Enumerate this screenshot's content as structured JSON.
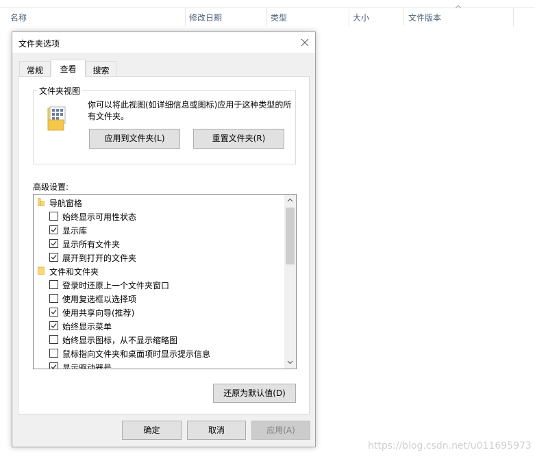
{
  "explorer": {
    "columns": [
      "名称",
      "修改日期",
      "类型",
      "大小",
      "文件版本"
    ]
  },
  "dialog": {
    "title": "文件夹选项",
    "tabs": [
      "常规",
      "查看",
      "搜索"
    ],
    "active_tab": "查看",
    "folder_view": {
      "title": "文件夹视图",
      "description": "你可以将此视图(如详细信息或图标)应用于这种类型的所有文件夹。",
      "apply_button": "应用到文件夹(L)",
      "reset_button": "重置文件夹(R)"
    },
    "advanced_label": "高级设置:",
    "advanced_items": [
      {
        "type": "group",
        "icon": "navigation-pane-icon",
        "label": "导航窗格"
      },
      {
        "type": "checkbox",
        "checked": false,
        "label": "始终显示可用性状态"
      },
      {
        "type": "checkbox",
        "checked": true,
        "label": "显示库"
      },
      {
        "type": "checkbox",
        "checked": true,
        "label": "显示所有文件夹"
      },
      {
        "type": "checkbox",
        "checked": true,
        "label": "展开到打开的文件夹"
      },
      {
        "type": "group",
        "icon": "folder-icon",
        "label": "文件和文件夹"
      },
      {
        "type": "checkbox",
        "checked": false,
        "label": "登录时还原上一个文件夹窗口"
      },
      {
        "type": "checkbox",
        "checked": false,
        "label": "使用复选框以选择项"
      },
      {
        "type": "checkbox",
        "checked": true,
        "label": "使用共享向导(推荐)"
      },
      {
        "type": "checkbox",
        "checked": true,
        "label": "始终显示菜单"
      },
      {
        "type": "checkbox",
        "checked": false,
        "label": "始终显示图标，从不显示缩略图"
      },
      {
        "type": "checkbox",
        "checked": false,
        "label": "鼠标指向文件夹和桌面项时显示提示信息"
      },
      {
        "type": "checkbox",
        "checked": true,
        "label": "显示驱动器号"
      }
    ],
    "restore_defaults_button": "还原为默认值(D)",
    "ok_button": "确定",
    "cancel_button": "取消",
    "apply_button": "应用(A)",
    "apply_enabled": false
  },
  "watermark": "https://blog.csdn.net/u011695973",
  "colors": {
    "header_text": "#4c607a",
    "folder_yellow": "#f8d775",
    "dialog_bg": "#f0f0f0",
    "button_bg": "#e1e1e1"
  }
}
